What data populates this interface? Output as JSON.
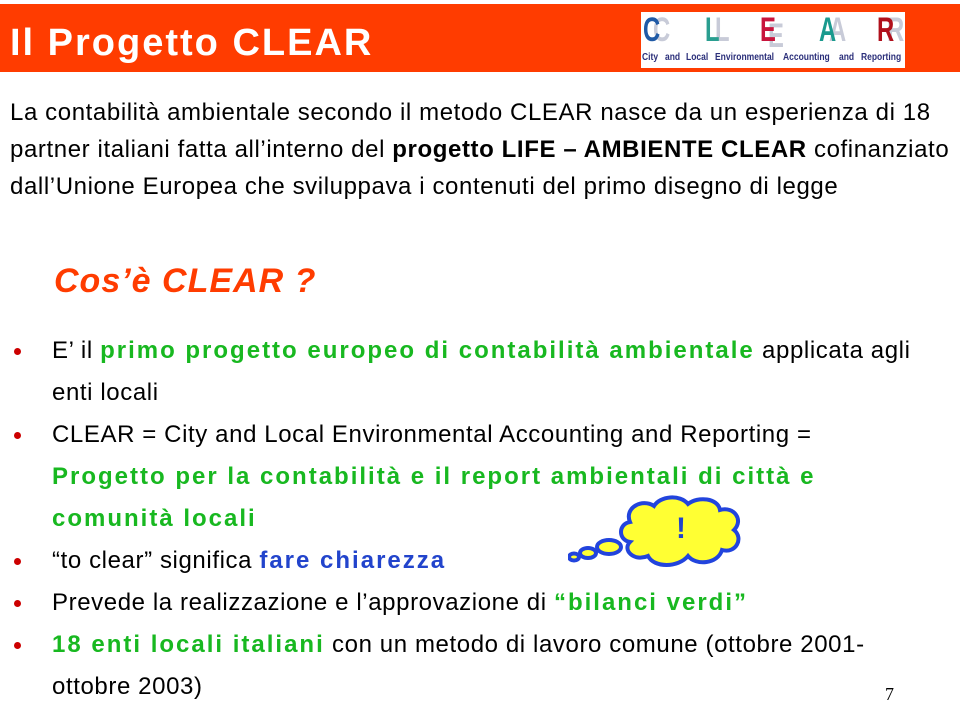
{
  "header": {
    "title": "Il Progetto CLEAR",
    "background_color": "#ff3c00"
  },
  "logo": {
    "letters": [
      "C",
      "L",
      "E",
      "A",
      "R"
    ],
    "letter_colors": [
      "#1f5aa6",
      "#2a9e90",
      "#c8143c",
      "#1a9a8e",
      "#b0101c"
    ],
    "tagline": [
      "City",
      "and",
      "Local",
      "Environmental",
      "Accounting",
      "and",
      "Reporting"
    ]
  },
  "intro": {
    "part1": "La contabilità ambientale  secondo il metodo CLEAR nasce da un esperienza di 18 partner italiani fatta all’interno del ",
    "bold": "progetto LIFE – AMBIENTE CLEAR",
    "part2": " cofinanziato dall’Unione Europea che sviluppava i contenuti del primo disegno di legge"
  },
  "subtitle": "Cos’è CLEAR ?",
  "bullets": [
    {
      "prefix": "E’ il ",
      "highlight": "primo progetto europeo di contabilità ambientale",
      "suffix": " applicata agli enti locali"
    },
    {
      "prefix": "CLEAR = City and Local Environmental Accounting and Reporting = ",
      "highlight": "Progetto per la contabilità e il report ambientali di città e comunità locali",
      "suffix": ""
    },
    {
      "prefix": "“to clear” significa ",
      "highlight": "fare chiarezza",
      "suffix": ""
    },
    {
      "prefix": "Prevede la realizzazione e l’approvazione di ",
      "highlight": "“bilanci verdi”",
      "suffix": ""
    },
    {
      "prefix": "",
      "highlight": "18 enti locali italiani",
      "suffix": " con un metodo di lavoro comune (ottobre 2001-ottobre 2003)"
    }
  ],
  "callout": {
    "icon": "thought-cloud-icon",
    "mark": "!",
    "fill_color": "#ffff33",
    "stroke_color": "#2244dd"
  },
  "colors": {
    "accent_red": "#ff3c00",
    "highlight_green": "#18b820",
    "highlight_blue": "#2244cc",
    "bullet": "#cc0000"
  },
  "page_number": "7"
}
